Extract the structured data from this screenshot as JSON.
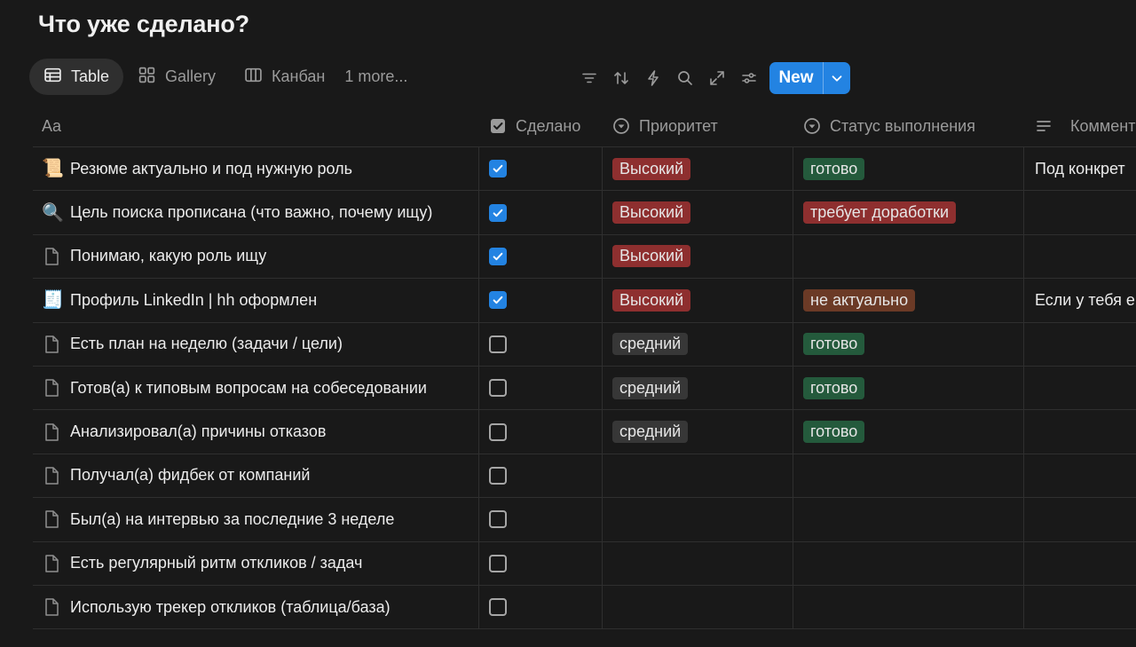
{
  "page": {
    "title": "Что уже сделано?"
  },
  "views": [
    {
      "label": "Table",
      "icon": "table-icon",
      "active": true
    },
    {
      "label": "Gallery",
      "icon": "gallery-icon",
      "active": false
    },
    {
      "label": "Канбан",
      "icon": "board-icon",
      "active": false
    }
  ],
  "views_more": "1 more...",
  "toolbar": {
    "icons": [
      "filter-icon",
      "sort-icon",
      "automation-icon",
      "search-icon",
      "expand-icon",
      "settings-icon"
    ],
    "new_label": "New"
  },
  "columns": {
    "title": "Aa",
    "done": "Сделано",
    "priority": "Приоритет",
    "status": "Статус выполнения",
    "comment": "Коммента"
  },
  "colors": {
    "accent": "#2383e2",
    "tag_high": "#8e2f2f",
    "tag_medium": "#373737",
    "tag_ready": "#245a3c",
    "tag_needs_work": "#8e2f2f",
    "tag_not_relevant": "#6b3a26"
  },
  "rows": [
    {
      "icon": "scroll-emoji",
      "emoji": "📜",
      "title": "Резюме актуально и под нужную роль",
      "done": true,
      "priority": "Высокий",
      "priority_color": "#8e2f2f",
      "status": "готово",
      "status_color": "#245a3c",
      "comment": "Под конкрет"
    },
    {
      "icon": "magnifier-emoji",
      "emoji": "🔍",
      "title": "Цель поиска прописана (что важно, почему ищу)",
      "done": true,
      "priority": "Высокий",
      "priority_color": "#8e2f2f",
      "status": "требует доработки",
      "status_color": "#8e2f2f",
      "comment": ""
    },
    {
      "icon": "page-icon",
      "emoji": "",
      "title": "Понимаю, какую роль ищу",
      "done": true,
      "priority": "Высокий",
      "priority_color": "#8e2f2f",
      "status": "",
      "status_color": "",
      "comment": ""
    },
    {
      "icon": "receipt-emoji",
      "emoji": "🧾",
      "title": "Профиль LinkedIn | hh  оформлен",
      "done": true,
      "priority": "Высокий",
      "priority_color": "#8e2f2f",
      "status": "не актуально",
      "status_color": "#6b3a26",
      "comment": "Если у тебя е"
    },
    {
      "icon": "page-icon",
      "emoji": "",
      "title": "Есть план на неделю (задачи / цели)",
      "done": false,
      "priority": "средний",
      "priority_color": "#373737",
      "status": "готово",
      "status_color": "#245a3c",
      "comment": ""
    },
    {
      "icon": "page-icon",
      "emoji": "",
      "title": "Готов(а) к типовым вопросам на собеседовании",
      "done": false,
      "priority": "средний",
      "priority_color": "#373737",
      "status": "готово",
      "status_color": "#245a3c",
      "comment": ""
    },
    {
      "icon": "page-icon",
      "emoji": "",
      "title": "Анализировал(а) причины отказов",
      "done": false,
      "priority": "средний",
      "priority_color": "#373737",
      "status": "готово",
      "status_color": "#245a3c",
      "comment": ""
    },
    {
      "icon": "page-icon",
      "emoji": "",
      "title": "Получал(а) фидбек от компаний",
      "done": false,
      "priority": "",
      "priority_color": "",
      "status": "",
      "status_color": "",
      "comment": ""
    },
    {
      "icon": "page-icon",
      "emoji": "",
      "title": "Был(а) на интервью за последние 3 неделе",
      "done": false,
      "priority": "",
      "priority_color": "",
      "status": "",
      "status_color": "",
      "comment": ""
    },
    {
      "icon": "page-icon",
      "emoji": "",
      "title": "Есть регулярный ритм откликов / задач",
      "done": false,
      "priority": "",
      "priority_color": "",
      "status": "",
      "status_color": "",
      "comment": ""
    },
    {
      "icon": "page-icon",
      "emoji": "",
      "title": "Использую трекер откликов (таблица/база)",
      "done": false,
      "priority": "",
      "priority_color": "",
      "status": "",
      "status_color": "",
      "comment": ""
    }
  ]
}
